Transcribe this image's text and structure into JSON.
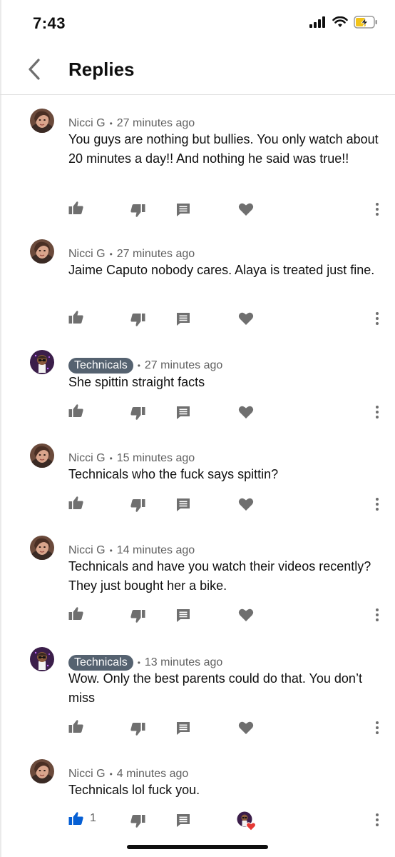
{
  "status": {
    "time": "7:43"
  },
  "header": {
    "title": "Replies"
  },
  "comments": [
    {
      "author": "Nicci G",
      "author_style": "plain",
      "avatar": "woman-photo",
      "time": "27 minutes ago",
      "text": "You guys are nothing but bullies. You only watch about 20 minutes a day!! And nothing he said was true!!"
    },
    {
      "author": "Nicci G",
      "author_style": "plain",
      "avatar": "woman-photo",
      "time": "27 minutes ago",
      "text": "Jaime Caputo nobody cares. Alaya is treated just fine."
    },
    {
      "author": "Technicals",
      "author_style": "badge",
      "avatar": "cartoon-avatar",
      "time": "27 minutes ago",
      "text": "She spittin straight facts"
    },
    {
      "author": "Nicci G",
      "author_style": "plain",
      "avatar": "woman-photo",
      "time": "15 minutes ago",
      "text": "Technicals who the fuck says spittin?"
    },
    {
      "author": "Nicci G",
      "author_style": "plain",
      "avatar": "woman-photo",
      "time": "14 minutes ago",
      "text": "Technicals and have you watch their videos recently? They just bought her a bike."
    },
    {
      "author": "Technicals",
      "author_style": "badge",
      "avatar": "cartoon-avatar",
      "time": "13 minutes ago",
      "text": "Wow. Only the best parents could do that. You don’t miss"
    },
    {
      "author": "Nicci G",
      "author_style": "plain",
      "avatar": "woman-photo",
      "time": "4 minutes ago",
      "text": "Technicals lol fuck you.",
      "like_count": "1",
      "liked": true,
      "creator_hearted": true
    }
  ],
  "colors": {
    "icon_grey": "#6f6f6f",
    "like_active": "#065fd4",
    "badge_bg": "#556270",
    "heart_red": "#e53935"
  },
  "icons": [
    "back-chevron-icon",
    "thumb-up-icon",
    "thumb-down-icon",
    "reply-icon",
    "heart-icon",
    "more-vert-icon"
  ]
}
